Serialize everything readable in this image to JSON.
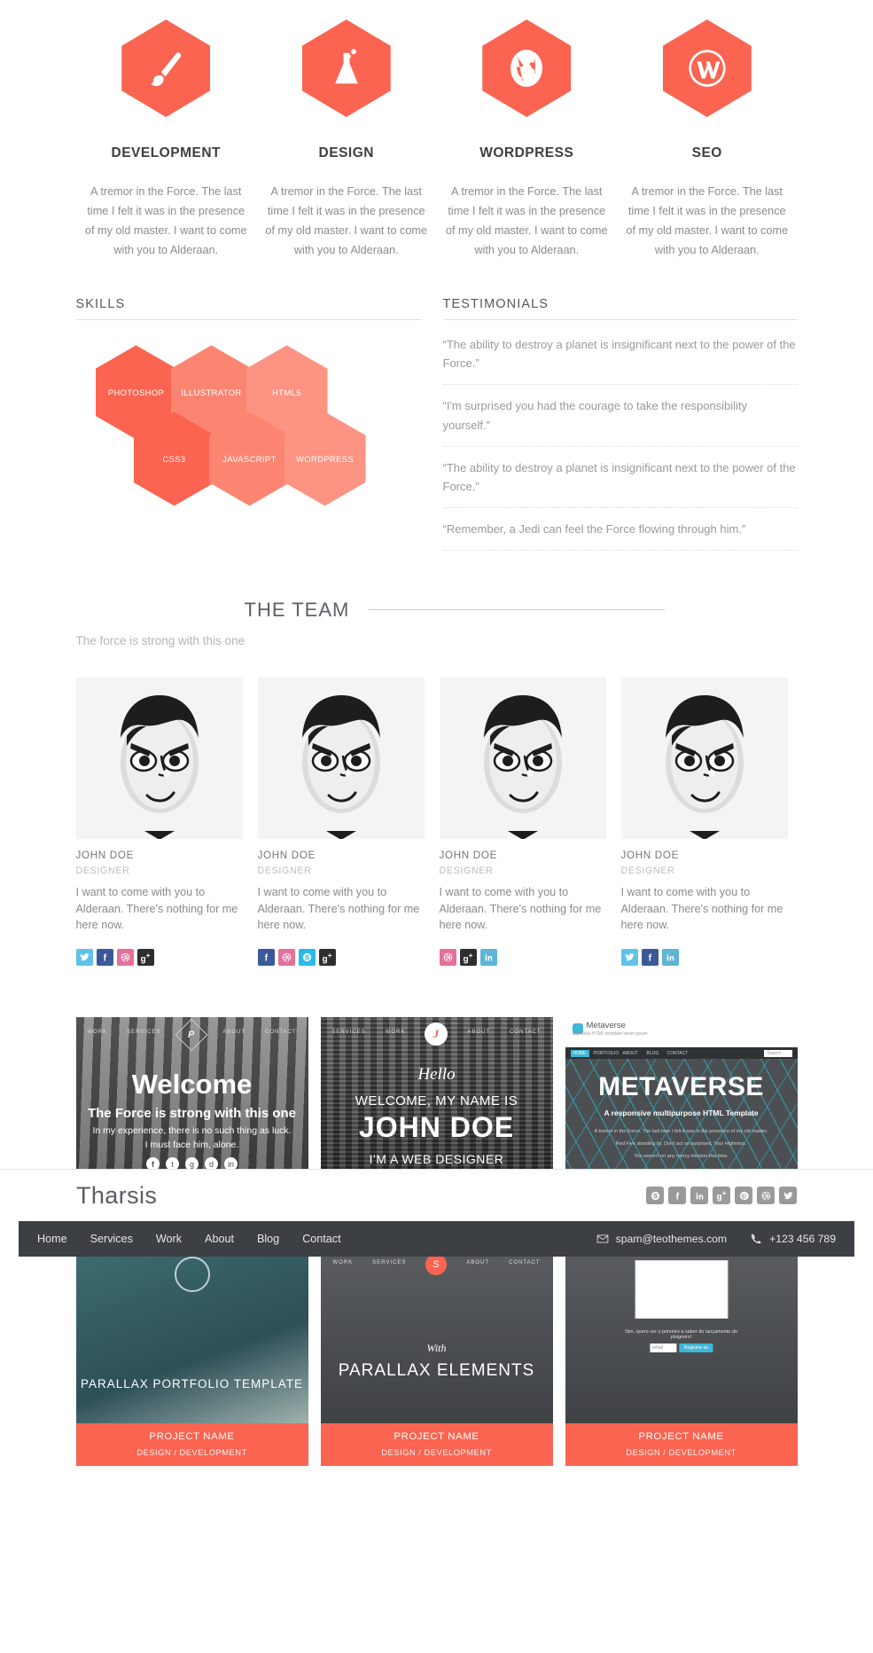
{
  "services": [
    {
      "icon": "paintbrush-icon",
      "title": "DEVELOPMENT",
      "text": "A tremor in the Force. The last time I felt it was in the presence of my old master. I want to come with you to Alderaan."
    },
    {
      "icon": "flask-icon",
      "title": "DESIGN",
      "text": "A tremor in the Force. The last time I felt it was in the presence of my old master. I want to come with you to Alderaan."
    },
    {
      "icon": "globe-icon",
      "title": "WORDPRESS",
      "text": "A tremor in the Force. The last time I felt it was in the presence of my old master. I want to come with you to Alderaan."
    },
    {
      "icon": "wordpress-icon",
      "title": "SEO",
      "text": "A tremor in the Force. The last time I felt it was in the presence of my old master. I want to come with you to Alderaan."
    }
  ],
  "skills": {
    "title": "SKILLS",
    "items": [
      {
        "label": "PHOTOSHOP",
        "color": "#fa6450"
      },
      {
        "label": "ILLUSTRATOR",
        "color": "#fc8572"
      },
      {
        "label": "HTML5",
        "color": "#fd9382"
      },
      {
        "label": "CSS3",
        "color": "#fa6450"
      },
      {
        "label": "JAVASCRIPT",
        "color": "#fc8572"
      },
      {
        "label": "WORDPRESS",
        "color": "#fd9382"
      }
    ]
  },
  "testimonials": {
    "title": "TESTIMONIALS",
    "items": [
      "“The ability to destroy a planet is insignificant next to the power of the Force.”",
      "“I'm surprised you had the courage to take the responsibility yourself.”",
      "“The ability to destroy a planet is insignificant next to the power of the Force.”",
      "“Remember, a Jedi can feel the Force flowing through him.”"
    ]
  },
  "team": {
    "title": "THE TEAM",
    "subtitle": "The force is strong with this one",
    "members": [
      {
        "name": "JOHN DOE",
        "role": "DESIGNER",
        "bio": "I want to come with you to Alderaan. There's nothing for me here now.",
        "socials": [
          {
            "icon": "twitter-icon",
            "color": "#5ec3e8"
          },
          {
            "icon": "facebook-icon",
            "color": "#3b5998"
          },
          {
            "icon": "dribbble-icon",
            "color": "#e4719b"
          },
          {
            "icon": "google-plus-icon",
            "color": "#2e2e2e"
          }
        ]
      },
      {
        "name": "JOHN DOE",
        "role": "DESIGNER",
        "bio": "I want to come with you to Alderaan. There's nothing for me here now.",
        "socials": [
          {
            "icon": "facebook-icon",
            "color": "#3b5998"
          },
          {
            "icon": "dribbble-icon",
            "color": "#e4719b"
          },
          {
            "icon": "skype-icon",
            "color": "#28baeb"
          },
          {
            "icon": "google-plus-icon",
            "color": "#2e2e2e"
          }
        ]
      },
      {
        "name": "JOHN DOE",
        "role": "DESIGNER",
        "bio": "I want to come with you to Alderaan. There's nothing for me here now.",
        "socials": [
          {
            "icon": "dribbble-icon",
            "color": "#e4719b"
          },
          {
            "icon": "google-plus-icon",
            "color": "#2e2e2e"
          },
          {
            "icon": "linkedin-icon",
            "color": "#5eb5d6"
          }
        ]
      },
      {
        "name": "JOHN DOE",
        "role": "DESIGNER",
        "bio": "I want to come with you to Alderaan. There's nothing for me here now.",
        "socials": [
          {
            "icon": "twitter-icon",
            "color": "#5ec3e8"
          },
          {
            "icon": "facebook-icon",
            "color": "#3b5998"
          },
          {
            "icon": "linkedin-icon",
            "color": "#5eb5d6"
          }
        ]
      }
    ]
  },
  "portfolio": {
    "caption_title": "PROJECT NAME",
    "caption_sub": "DESIGN / DEVELOPMENT",
    "projects": [
      {
        "kind": "forest",
        "nav": [
          "WORK",
          "SERVICES",
          "ABOUT",
          "CONTACT"
        ],
        "logo": "P",
        "h1": "Welcome",
        "h2": "The Force is strong with this one",
        "p1": "In my experience, there is no such thing as luck.",
        "p2": "I must face him, alone.",
        "socials": [
          "facebook-icon",
          "twitter-icon",
          "google-plus-icon",
          "dribbble-icon",
          "linkedin-icon"
        ]
      },
      {
        "kind": "city",
        "nav": [
          "SERVICES",
          "WORK",
          "ABOUT",
          "CONTACT"
        ],
        "logo": "J",
        "script": "Hello",
        "h2": "WELCOME, MY NAME IS",
        "h1": "JOHN DOE",
        "h3": "I'M A WEB DESIGNER"
      },
      {
        "kind": "metaverse",
        "brandname": "Metaverse",
        "tagline": "aspiniove HTML template lorem ipsum",
        "nav": [
          "HOME",
          "PORTFOLIO",
          "ABOUT",
          "BLOG",
          "CONTACT"
        ],
        "search": "Search...",
        "h1": "METAVERSE",
        "h2": "A responsive multipurpose HTML Template",
        "p1": "A tremor in the Force. The last time I felt it was in the presence of my old master.",
        "p2": "Red Five standing by. Don't act so surprised, Your Highness.",
        "p3": "You weren't on any mercy mission this time."
      },
      {
        "kind": "sea",
        "h1": "PARALLAX PORTFOLIO TEMPLATE"
      },
      {
        "kind": "parallax",
        "nav": [
          "WORK",
          "SERVICES",
          "ABOUT",
          "CONTACT"
        ],
        "logo": "S",
        "script": "With",
        "h1": "PARALLAX ELEMENTS"
      },
      {
        "kind": "mockup",
        "p": "Sim, quero ser o primeiro a saber do lançamento do plsigners!",
        "field": "email",
        "button": "Registrar-se"
      }
    ]
  },
  "footer": {
    "brand": "Tharsis",
    "socials": [
      "skype-icon",
      "facebook-icon",
      "linkedin-icon",
      "google-plus-icon",
      "pinterest-icon",
      "dribbble-icon",
      "twitter-icon"
    ],
    "nav": [
      "Home",
      "Services",
      "Work",
      "About",
      "Blog",
      "Contact"
    ],
    "email": "spam@teothemes.com",
    "phone": "+123 456 789"
  },
  "colors": {
    "accent": "#fa6450",
    "dark": "#3c3f43",
    "muted": "#9a9a9a"
  }
}
